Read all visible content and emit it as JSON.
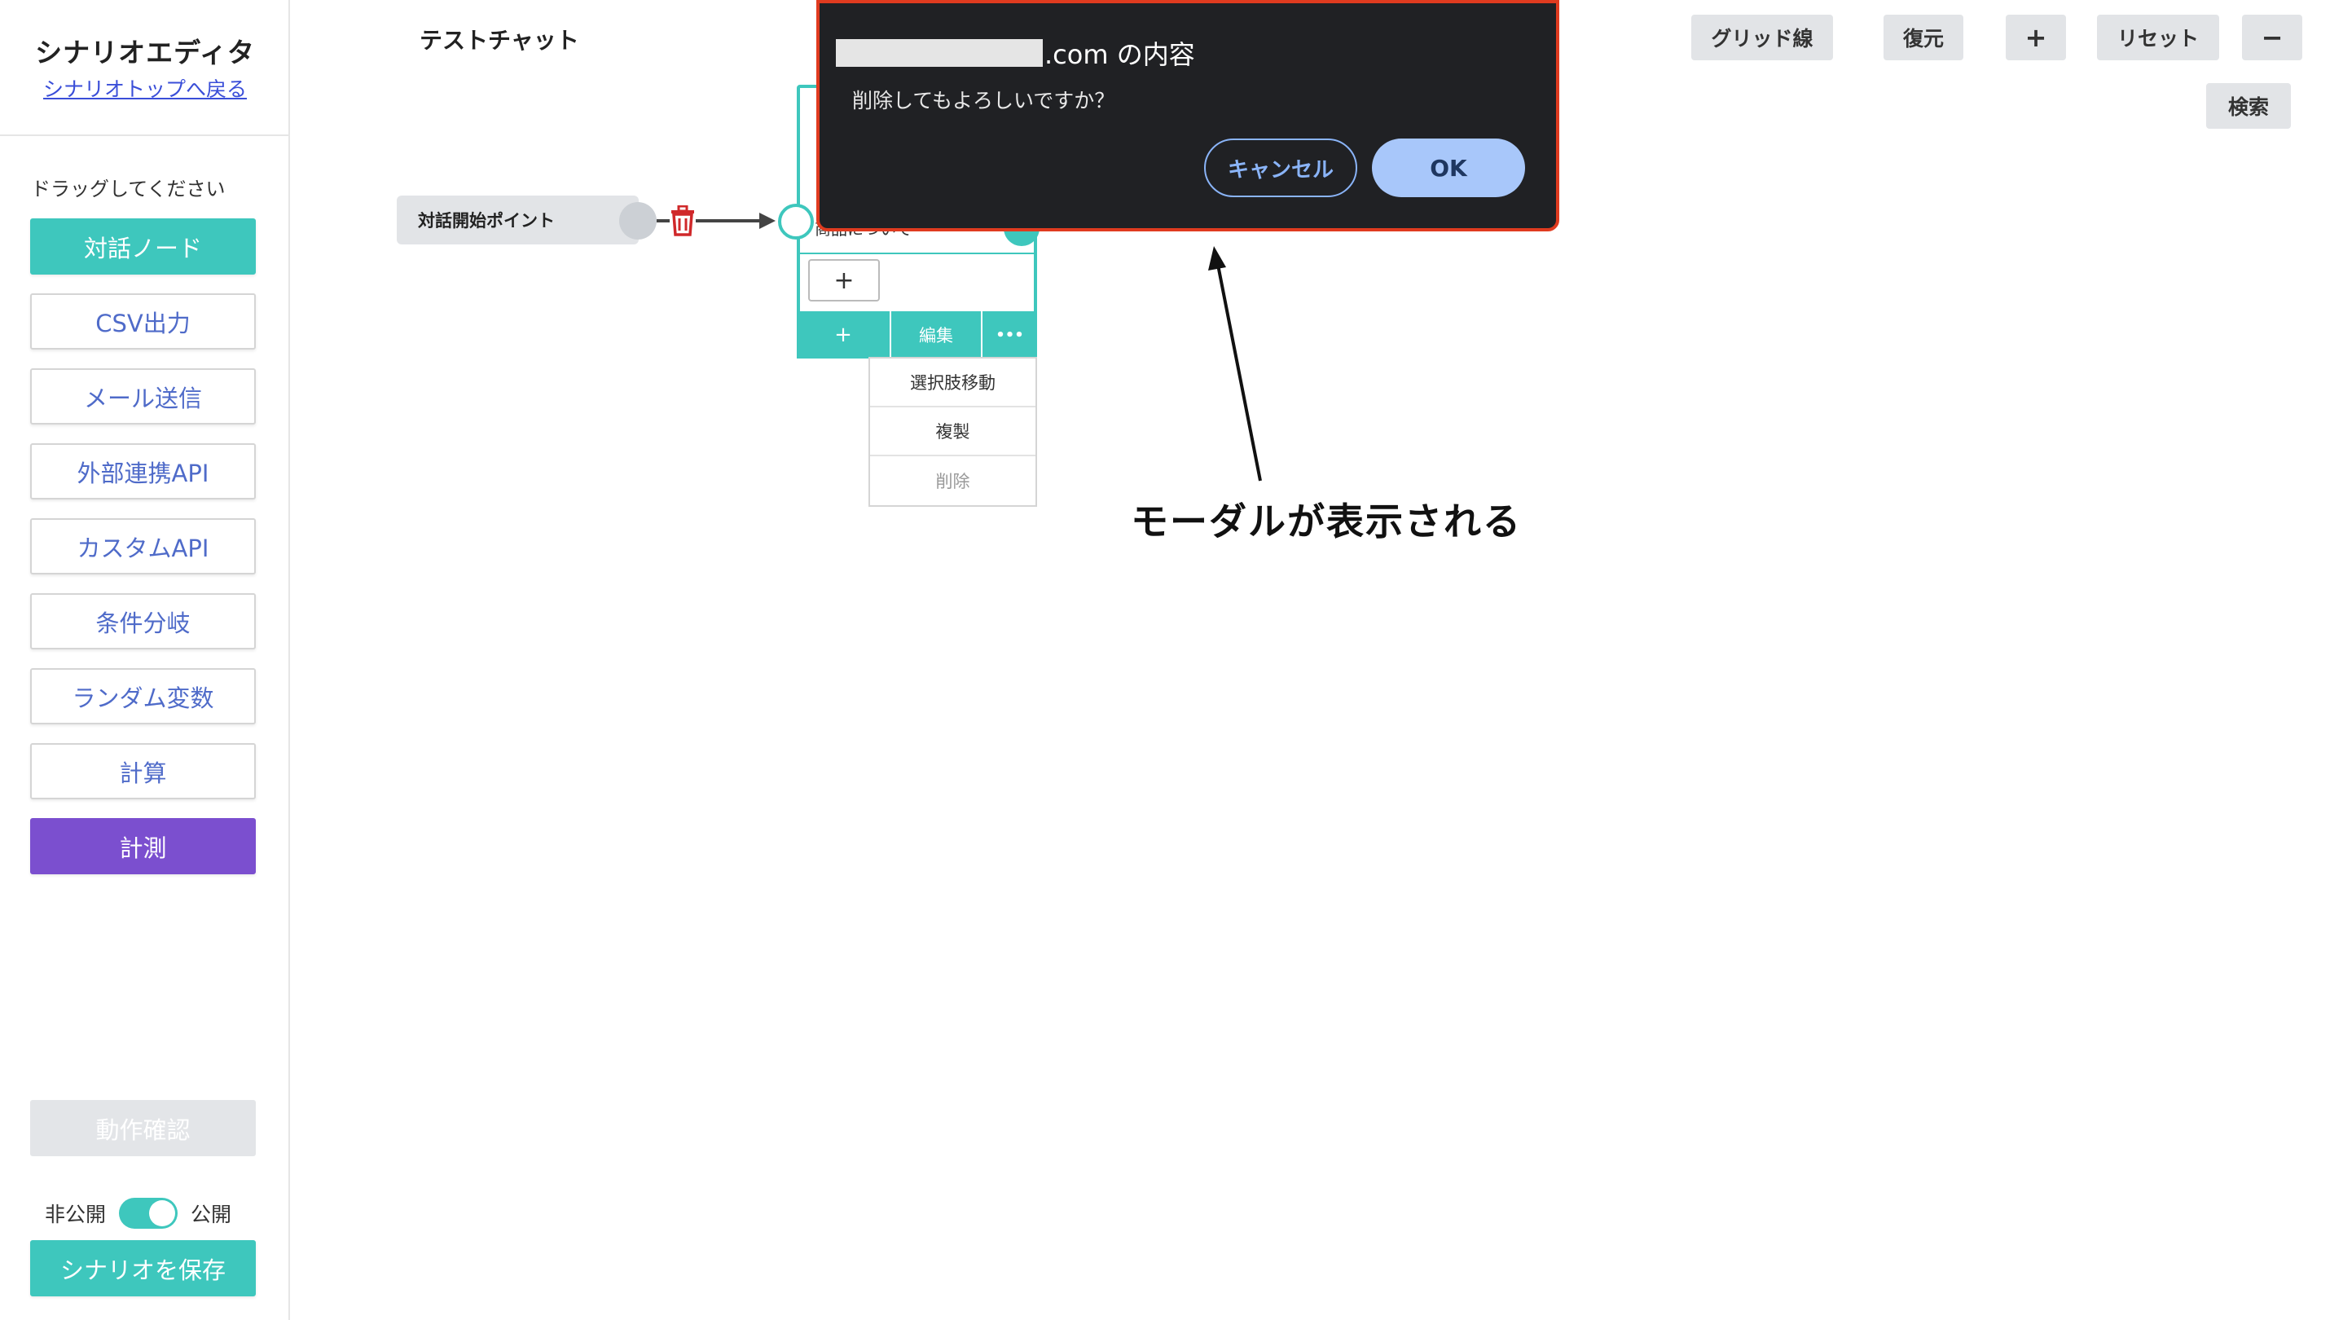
{
  "sidebar": {
    "title": "シナリオエディタ",
    "back_link": "シナリオトップへ戻る",
    "drag_hint": "ドラッグしてください",
    "items": [
      {
        "label": "対話ノード"
      },
      {
        "label": "CSV出力"
      },
      {
        "label": "メール送信"
      },
      {
        "label": "外部連携API"
      },
      {
        "label": "カスタムAPI"
      },
      {
        "label": "条件分岐"
      },
      {
        "label": "ランダム変数"
      },
      {
        "label": "計算"
      },
      {
        "label": "計測"
      }
    ],
    "test_button": "動作確認",
    "toggle_off_label": "非公開",
    "toggle_on_label": "公開",
    "save_button": "シナリオを保存"
  },
  "header": {
    "chat_title": "テストチャット",
    "toolbar": {
      "grid": "グリッド線",
      "restore": "復元",
      "zoom_in": "+",
      "reset": "リセット",
      "zoom_out": "−",
      "search": "検索"
    }
  },
  "flow": {
    "start_node_label": "対話開始ポイント",
    "dialog_node_text": "商品について",
    "choice_add": "+",
    "footer": {
      "add": "+",
      "edit": "編集",
      "more": "•••"
    },
    "menu": [
      "選択肢移動",
      "複製",
      "削除"
    ]
  },
  "modal": {
    "title_suffix": ".com の内容",
    "message": "削除してもよろしいですか？",
    "cancel": "キャンセル",
    "ok": "OK"
  },
  "annotation": "モーダルが表示される",
  "colors": {
    "teal": "#3ec7bd",
    "purple": "#7b4fcf",
    "modal_bg": "#202124",
    "highlight": "#e03b1f",
    "ok_button": "#a8c7fa"
  }
}
